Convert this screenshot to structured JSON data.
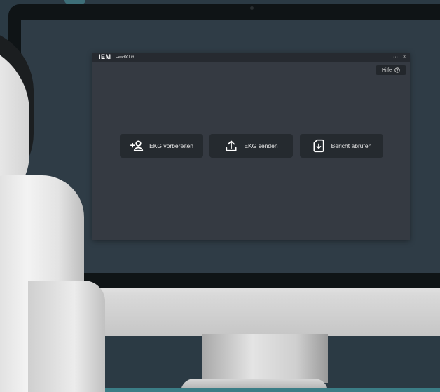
{
  "app": {
    "logo": "IEM",
    "name": "HeartX Lift",
    "controls": {
      "more": "···",
      "close": "×"
    }
  },
  "help": {
    "label": "Hilfe",
    "icon": "help-circle-icon"
  },
  "actions": [
    {
      "label": "EKG vorbereiten",
      "icon": "add-person-icon"
    },
    {
      "label": "EKG senden",
      "icon": "upload-icon"
    },
    {
      "label": "Bericht abrufen",
      "icon": "download-document-icon"
    }
  ],
  "colors": {
    "window_bg": "#353a42",
    "titlebar_bg": "#262a30",
    "button_bg": "#252a2f",
    "text": "#e8e8e8",
    "backdrop": "#2b3a44"
  }
}
